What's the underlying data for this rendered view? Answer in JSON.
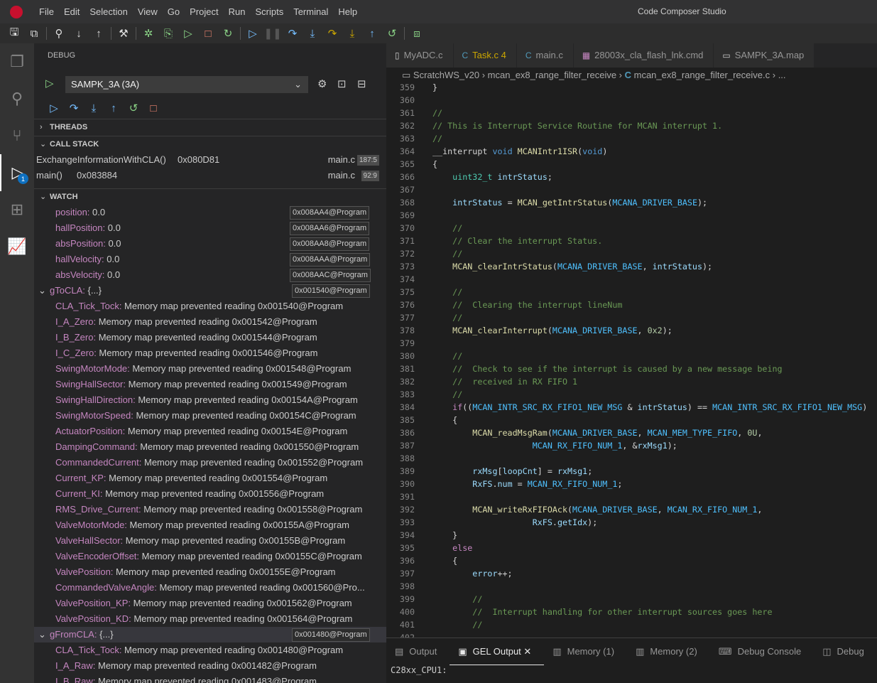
{
  "title_bar": {
    "menu": [
      "File",
      "Edit",
      "Selection",
      "View",
      "Go",
      "Project",
      "Run",
      "Scripts",
      "Terminal",
      "Help"
    ],
    "title": "Code Composer Studio"
  },
  "sidebar": {
    "title": "DEBUG",
    "launch_config": "SAMPK_3A (3A)",
    "threads_label": "THREADS",
    "callstack_label": "CALL STACK",
    "watch_label": "WATCH",
    "call_stack": [
      {
        "function": "ExchangeInformationWithCLA()",
        "address": "0x080D81",
        "file": "main.c",
        "line": "187:5"
      },
      {
        "function": "main()",
        "address": "0x083884",
        "file": "main.c",
        "line": "92:9"
      }
    ],
    "watch": [
      {
        "indent": 30,
        "expander": "",
        "name": "position:",
        "value": " 0.0",
        "address": "0x008AA4@Program"
      },
      {
        "indent": 30,
        "expander": "",
        "name": "hallPosition:",
        "value": " 0.0",
        "address": "0x008AA6@Program"
      },
      {
        "indent": 30,
        "expander": "",
        "name": "absPosition:",
        "value": " 0.0",
        "address": "0x008AA8@Program"
      },
      {
        "indent": 30,
        "expander": "",
        "name": "hallVelocity:",
        "value": " 0.0",
        "address": "0x008AAA@Program"
      },
      {
        "indent": 30,
        "expander": "",
        "name": "absVelocity:",
        "value": " 0.0",
        "address": "0x008AAC@Program"
      },
      {
        "indent": 6,
        "expander": "⌄",
        "name": "gToCLA:",
        "value": " {...}",
        "address": "0x001540@Program"
      },
      {
        "indent": 30,
        "expander": "",
        "name": "CLA_Tick_Tock:",
        "value": " Memory map prevented reading 0x001540@Program",
        "address": ""
      },
      {
        "indent": 30,
        "expander": "",
        "name": "I_A_Zero:",
        "value": " Memory map prevented reading 0x001542@Program",
        "address": ""
      },
      {
        "indent": 30,
        "expander": "",
        "name": "I_B_Zero:",
        "value": " Memory map prevented reading 0x001544@Program",
        "address": ""
      },
      {
        "indent": 30,
        "expander": "",
        "name": "I_C_Zero:",
        "value": " Memory map prevented reading 0x001546@Program",
        "address": ""
      },
      {
        "indent": 30,
        "expander": "",
        "name": "SwingMotorMode:",
        "value": " Memory map prevented reading 0x001548@Program",
        "address": ""
      },
      {
        "indent": 30,
        "expander": "",
        "name": "SwingHallSector:",
        "value": " Memory map prevented reading 0x001549@Program",
        "address": ""
      },
      {
        "indent": 30,
        "expander": "",
        "name": "SwingHallDirection:",
        "value": " Memory map prevented reading 0x00154A@Program",
        "address": ""
      },
      {
        "indent": 30,
        "expander": "",
        "name": "SwingMotorSpeed:",
        "value": " Memory map prevented reading 0x00154C@Program",
        "address": ""
      },
      {
        "indent": 30,
        "expander": "",
        "name": "ActuatorPosition:",
        "value": " Memory map prevented reading 0x00154E@Program",
        "address": ""
      },
      {
        "indent": 30,
        "expander": "",
        "name": "DampingCommand:",
        "value": " Memory map prevented reading 0x001550@Program",
        "address": ""
      },
      {
        "indent": 30,
        "expander": "",
        "name": "CommandedCurrent:",
        "value": " Memory map prevented reading 0x001552@Program",
        "address": ""
      },
      {
        "indent": 30,
        "expander": "",
        "name": "Current_KP:",
        "value": " Memory map prevented reading 0x001554@Program",
        "address": ""
      },
      {
        "indent": 30,
        "expander": "",
        "name": "Current_KI:",
        "value": " Memory map prevented reading 0x001556@Program",
        "address": ""
      },
      {
        "indent": 30,
        "expander": "",
        "name": "RMS_Drive_Current:",
        "value": " Memory map prevented reading 0x001558@Program",
        "address": ""
      },
      {
        "indent": 30,
        "expander": "",
        "name": "ValveMotorMode:",
        "value": " Memory map prevented reading 0x00155A@Program",
        "address": ""
      },
      {
        "indent": 30,
        "expander": "",
        "name": "ValveHallSector:",
        "value": " Memory map prevented reading 0x00155B@Program",
        "address": ""
      },
      {
        "indent": 30,
        "expander": "",
        "name": "ValveEncoderOffset:",
        "value": " Memory map prevented reading 0x00155C@Program",
        "address": ""
      },
      {
        "indent": 30,
        "expander": "",
        "name": "ValvePosition:",
        "value": " Memory map prevented reading 0x00155E@Program",
        "address": ""
      },
      {
        "indent": 30,
        "expander": "",
        "name": "CommandedValveAngle:",
        "value": " Memory map prevented reading 0x001560@Pro...",
        "address": ""
      },
      {
        "indent": 30,
        "expander": "",
        "name": "ValvePosition_KP:",
        "value": " Memory map prevented reading 0x001562@Program",
        "address": ""
      },
      {
        "indent": 30,
        "expander": "",
        "name": "ValvePosition_KD:",
        "value": " Memory map prevented reading 0x001564@Program",
        "address": ""
      },
      {
        "indent": 6,
        "expander": "⌄",
        "name": "gFromCLA:",
        "value": " {...}",
        "address": "0x001480@Program",
        "selected": true
      },
      {
        "indent": 30,
        "expander": "",
        "name": "CLA_Tick_Tock:",
        "value": " Memory map prevented reading 0x001480@Program",
        "address": ""
      },
      {
        "indent": 30,
        "expander": "",
        "name": "I_A_Raw:",
        "value": " Memory map prevented reading 0x001482@Program",
        "address": ""
      },
      {
        "indent": 30,
        "expander": "",
        "name": "I_B_Raw:",
        "value": " Memory map prevented reading 0x001483@Program",
        "address": ""
      }
    ]
  },
  "editor": {
    "tabs": [
      {
        "icon": "▯",
        "icon_color": "#cccccc",
        "label": "MyADC.c",
        "label_color": "#969696",
        "suffix": ""
      },
      {
        "icon": "C",
        "icon_color": "#519aba",
        "label": "Task.c",
        "label_color": "#cca700",
        "suffix": " 4"
      },
      {
        "icon": "C",
        "icon_color": "#519aba",
        "label": "main.c",
        "label_color": "#969696",
        "suffix": ""
      },
      {
        "icon": "▦",
        "icon_color": "#c586c0",
        "label": "28003x_cla_flash_lnk.cmd",
        "label_color": "#969696",
        "suffix": ""
      },
      {
        "icon": "▭",
        "icon_color": "#cccccc",
        "label": "SAMPK_3A.map",
        "label_color": "#969696",
        "suffix": ""
      }
    ],
    "breadcrumb": [
      "ScratchWS_v20",
      "mcan_ex8_range_filter_receive",
      "mcan_ex8_range_filter_receive.c",
      "..."
    ],
    "lines": [
      {
        "n": "359",
        "t": [
          [
            "ct",
            "}"
          ]
        ]
      },
      {
        "n": "360",
        "t": []
      },
      {
        "n": "361",
        "t": [
          [
            "cm",
            "//"
          ]
        ]
      },
      {
        "n": "362",
        "t": [
          [
            "cm",
            "// This is Interrupt Service Routine for MCAN interrupt 1."
          ]
        ]
      },
      {
        "n": "363",
        "t": [
          [
            "cm",
            "//"
          ]
        ]
      },
      {
        "n": "364",
        "t": [
          [
            "ct",
            "__interrupt "
          ],
          [
            "kw",
            "void"
          ],
          [
            "ct",
            " "
          ],
          [
            "fn",
            "MCANIntr1ISR"
          ],
          [
            "ct",
            "("
          ],
          [
            "kw",
            "void"
          ],
          [
            "ct",
            ")"
          ]
        ]
      },
      {
        "n": "365",
        "t": [
          [
            "ct",
            "{"
          ]
        ]
      },
      {
        "n": "366",
        "t": [
          [
            "ct",
            "    "
          ],
          [
            "ty",
            "uint32_t"
          ],
          [
            "ct",
            " "
          ],
          [
            "vr",
            "intrStatus"
          ],
          [
            "ct",
            ";"
          ]
        ]
      },
      {
        "n": "367",
        "t": []
      },
      {
        "n": "368",
        "t": [
          [
            "ct",
            "    "
          ],
          [
            "vr",
            "intrStatus"
          ],
          [
            "ct",
            " = "
          ],
          [
            "fn",
            "MCAN_getIntrStatus"
          ],
          [
            "ct",
            "("
          ],
          [
            "mc",
            "MCANA_DRIVER_BASE"
          ],
          [
            "ct",
            ");"
          ]
        ]
      },
      {
        "n": "369",
        "t": []
      },
      {
        "n": "370",
        "t": [
          [
            "ct",
            "    "
          ],
          [
            "cm",
            "//"
          ]
        ]
      },
      {
        "n": "371",
        "t": [
          [
            "ct",
            "    "
          ],
          [
            "cm",
            "// Clear the interrupt Status."
          ]
        ]
      },
      {
        "n": "372",
        "t": [
          [
            "ct",
            "    "
          ],
          [
            "cm",
            "//"
          ]
        ]
      },
      {
        "n": "373",
        "t": [
          [
            "ct",
            "    "
          ],
          [
            "fn",
            "MCAN_clearIntrStatus"
          ],
          [
            "ct",
            "("
          ],
          [
            "mc",
            "MCANA_DRIVER_BASE"
          ],
          [
            "ct",
            ", "
          ],
          [
            "vr",
            "intrStatus"
          ],
          [
            "ct",
            ");"
          ]
        ]
      },
      {
        "n": "374",
        "t": []
      },
      {
        "n": "375",
        "t": [
          [
            "ct",
            "    "
          ],
          [
            "cm",
            "//"
          ]
        ]
      },
      {
        "n": "376",
        "t": [
          [
            "ct",
            "    "
          ],
          [
            "cm",
            "//  Clearing the interrupt lineNum"
          ]
        ]
      },
      {
        "n": "377",
        "t": [
          [
            "ct",
            "    "
          ],
          [
            "cm",
            "//"
          ]
        ]
      },
      {
        "n": "378",
        "t": [
          [
            "ct",
            "    "
          ],
          [
            "fn",
            "MCAN_clearInterrupt"
          ],
          [
            "ct",
            "("
          ],
          [
            "mc",
            "MCANA_DRIVER_BASE"
          ],
          [
            "ct",
            ", "
          ],
          [
            "nm",
            "0x2"
          ],
          [
            "ct",
            ");"
          ]
        ]
      },
      {
        "n": "379",
        "t": []
      },
      {
        "n": "380",
        "t": [
          [
            "ct",
            "    "
          ],
          [
            "cm",
            "//"
          ]
        ]
      },
      {
        "n": "381",
        "t": [
          [
            "ct",
            "    "
          ],
          [
            "cm",
            "//  Check to see if the interrupt is caused by a new message being"
          ]
        ]
      },
      {
        "n": "382",
        "t": [
          [
            "ct",
            "    "
          ],
          [
            "cm",
            "//  received in RX FIFO 1"
          ]
        ]
      },
      {
        "n": "383",
        "t": [
          [
            "ct",
            "    "
          ],
          [
            "cm",
            "//"
          ]
        ]
      },
      {
        "n": "384",
        "t": [
          [
            "ct",
            "    "
          ],
          [
            "cf",
            "if"
          ],
          [
            "ct",
            "(("
          ],
          [
            "mc",
            "MCAN_INTR_SRC_RX_FIFO1_NEW_MSG"
          ],
          [
            "ct",
            " & "
          ],
          [
            "vr",
            "intrStatus"
          ],
          [
            "ct",
            ") == "
          ],
          [
            "mc",
            "MCAN_INTR_SRC_RX_FIFO1_NEW_MSG"
          ],
          [
            "ct",
            ")"
          ]
        ]
      },
      {
        "n": "385",
        "t": [
          [
            "ct",
            "    {"
          ]
        ]
      },
      {
        "n": "386",
        "t": [
          [
            "ct",
            "        "
          ],
          [
            "fn",
            "MCAN_readMsgRam"
          ],
          [
            "ct",
            "("
          ],
          [
            "mc",
            "MCANA_DRIVER_BASE"
          ],
          [
            "ct",
            ", "
          ],
          [
            "mc",
            "MCAN_MEM_TYPE_FIFO"
          ],
          [
            "ct",
            ", "
          ],
          [
            "nm",
            "0U"
          ],
          [
            "ct",
            ","
          ]
        ]
      },
      {
        "n": "387",
        "t": [
          [
            "ct",
            "                    "
          ],
          [
            "mc",
            "MCAN_RX_FIFO_NUM_1"
          ],
          [
            "ct",
            ", &"
          ],
          [
            "vr",
            "rxMsg1"
          ],
          [
            "ct",
            ");"
          ]
        ]
      },
      {
        "n": "388",
        "t": []
      },
      {
        "n": "389",
        "t": [
          [
            "ct",
            "        "
          ],
          [
            "vr",
            "rxMsg"
          ],
          [
            "ct",
            "["
          ],
          [
            "vr",
            "loopCnt"
          ],
          [
            "ct",
            "] = "
          ],
          [
            "vr",
            "rxMsg1"
          ],
          [
            "ct",
            ";"
          ]
        ]
      },
      {
        "n": "390",
        "t": [
          [
            "ct",
            "        "
          ],
          [
            "vr",
            "RxFS"
          ],
          [
            "ct",
            "."
          ],
          [
            "vr",
            "num"
          ],
          [
            "ct",
            " = "
          ],
          [
            "mc",
            "MCAN_RX_FIFO_NUM_1"
          ],
          [
            "ct",
            ";"
          ]
        ]
      },
      {
        "n": "391",
        "t": []
      },
      {
        "n": "392",
        "t": [
          [
            "ct",
            "        "
          ],
          [
            "fn",
            "MCAN_writeRxFIFOAck"
          ],
          [
            "ct",
            "("
          ],
          [
            "mc",
            "MCANA_DRIVER_BASE"
          ],
          [
            "ct",
            ", "
          ],
          [
            "mc",
            "MCAN_RX_FIFO_NUM_1"
          ],
          [
            "ct",
            ","
          ]
        ]
      },
      {
        "n": "393",
        "t": [
          [
            "ct",
            "                    "
          ],
          [
            "vr",
            "RxFS"
          ],
          [
            "ct",
            "."
          ],
          [
            "vr",
            "getIdx"
          ],
          [
            "ct",
            ");"
          ]
        ]
      },
      {
        "n": "394",
        "t": [
          [
            "ct",
            "    }"
          ]
        ]
      },
      {
        "n": "395",
        "t": [
          [
            "ct",
            "    "
          ],
          [
            "cf",
            "else"
          ]
        ]
      },
      {
        "n": "396",
        "t": [
          [
            "ct",
            "    {"
          ]
        ]
      },
      {
        "n": "397",
        "t": [
          [
            "ct",
            "        "
          ],
          [
            "vr",
            "error"
          ],
          [
            "ct",
            "++;"
          ]
        ]
      },
      {
        "n": "398",
        "t": []
      },
      {
        "n": "399",
        "t": [
          [
            "ct",
            "        "
          ],
          [
            "cm",
            "//"
          ]
        ]
      },
      {
        "n": "400",
        "t": [
          [
            "ct",
            "        "
          ],
          [
            "cm",
            "//  Interrupt handling for other interrupt sources goes here"
          ]
        ]
      },
      {
        "n": "401",
        "t": [
          [
            "ct",
            "        "
          ],
          [
            "cm",
            "//"
          ]
        ]
      },
      {
        "n": "402",
        "t": []
      }
    ]
  },
  "panel": {
    "tabs": [
      {
        "icon": "▤",
        "label": "Output",
        "active": false
      },
      {
        "icon": "▣",
        "label": "GEL Output",
        "active": true
      },
      {
        "icon": "▥",
        "label": "Memory (1)",
        "active": false
      },
      {
        "icon": "▥",
        "label": "Memory (2)",
        "active": false
      },
      {
        "icon": "⌨",
        "label": "Debug Console",
        "active": false
      },
      {
        "icon": "◫",
        "label": "Debug",
        "active": false
      }
    ],
    "content": "C28xx_CPU1:"
  }
}
